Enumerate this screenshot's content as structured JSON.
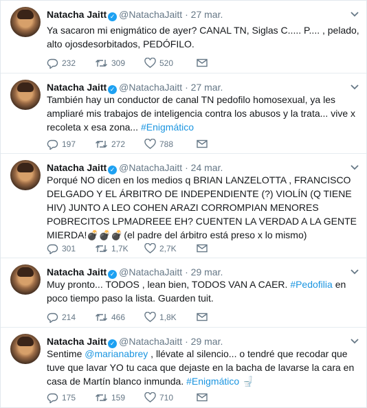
{
  "tweets": [
    {
      "name": "Natacha Jaitt",
      "handle": "@NatachaJaitt",
      "date": "27 mar.",
      "text": "Ya sacaron mi enigmático de ayer? CANAL TN, Siglas C..... P.... , pelado, alto ojosdesorbitados, PEDÓFILO.",
      "replies": "232",
      "retweets": "309",
      "likes": "520"
    },
    {
      "name": "Natacha Jaitt",
      "handle": "@NatachaJaitt",
      "date": "27 mar.",
      "text": "También hay un conductor de canal TN pedofilo homosexual, ya les ampliaré mis trabajos de inteligencia contra los abusos y la trata... vive x recoleta x esa zona...",
      "hashtag": "#Enigmático",
      "replies": "197",
      "retweets": "272",
      "likes": "788"
    },
    {
      "name": "Natacha Jaitt",
      "handle": "@NatachaJaitt",
      "date": "24 mar.",
      "text": "Porqué NO dicen en los medios q BRIAN LANZELOTTA , FRANCISCO DELGADO Y EL ÁRBITRO DE INDEPENDIENTE (?) VIOLÍN (Q TIENE HIV) JUNTO A LEO COHEN ARAZI CORROMPIAN MENORES POBRECITOS LPMADREEE EH? CUENTEN LA VERDAD A LA GENTE MIERDA!",
      "emoji": "💣 💣 💣",
      "text_after": "(el padre del árbitro está preso x lo mismo)",
      "replies": "301",
      "retweets": "1,7K",
      "likes": "2,7K"
    },
    {
      "name": "Natacha Jaitt",
      "handle": "@NatachaJaitt",
      "date": "29 mar.",
      "text": "Muy pronto... TODOS , lean bien, TODOS VAN A CAER.",
      "hashtag": "#Pedofilia",
      "text_after": "en poco tiempo paso la lista. Guarden tuit.",
      "replies": "214",
      "retweets": "466",
      "likes": "1,8K"
    },
    {
      "name": "Natacha Jaitt",
      "handle": "@NatachaJaitt",
      "date": "29 mar.",
      "text": "Sentime",
      "mention": "@marianabrey",
      "text_after": ", llévate al silencio... o tendré que recodar que tuve que lavar YO tu caca que dejaste en la bacha de lavarse la cara en casa de Martín blanco inmunda.",
      "hashtag": "#Enigmático",
      "emoji": "🚽",
      "replies": "175",
      "retweets": "159",
      "likes": "710"
    }
  ],
  "icons": {
    "reply": "reply-icon",
    "retweet": "retweet-icon",
    "like": "heart-icon",
    "message": "envelope-icon",
    "caret": "chevron-down-icon"
  },
  "colors": {
    "link": "#1b95e0",
    "verified": "#1da1f2",
    "muted": "#657786"
  }
}
